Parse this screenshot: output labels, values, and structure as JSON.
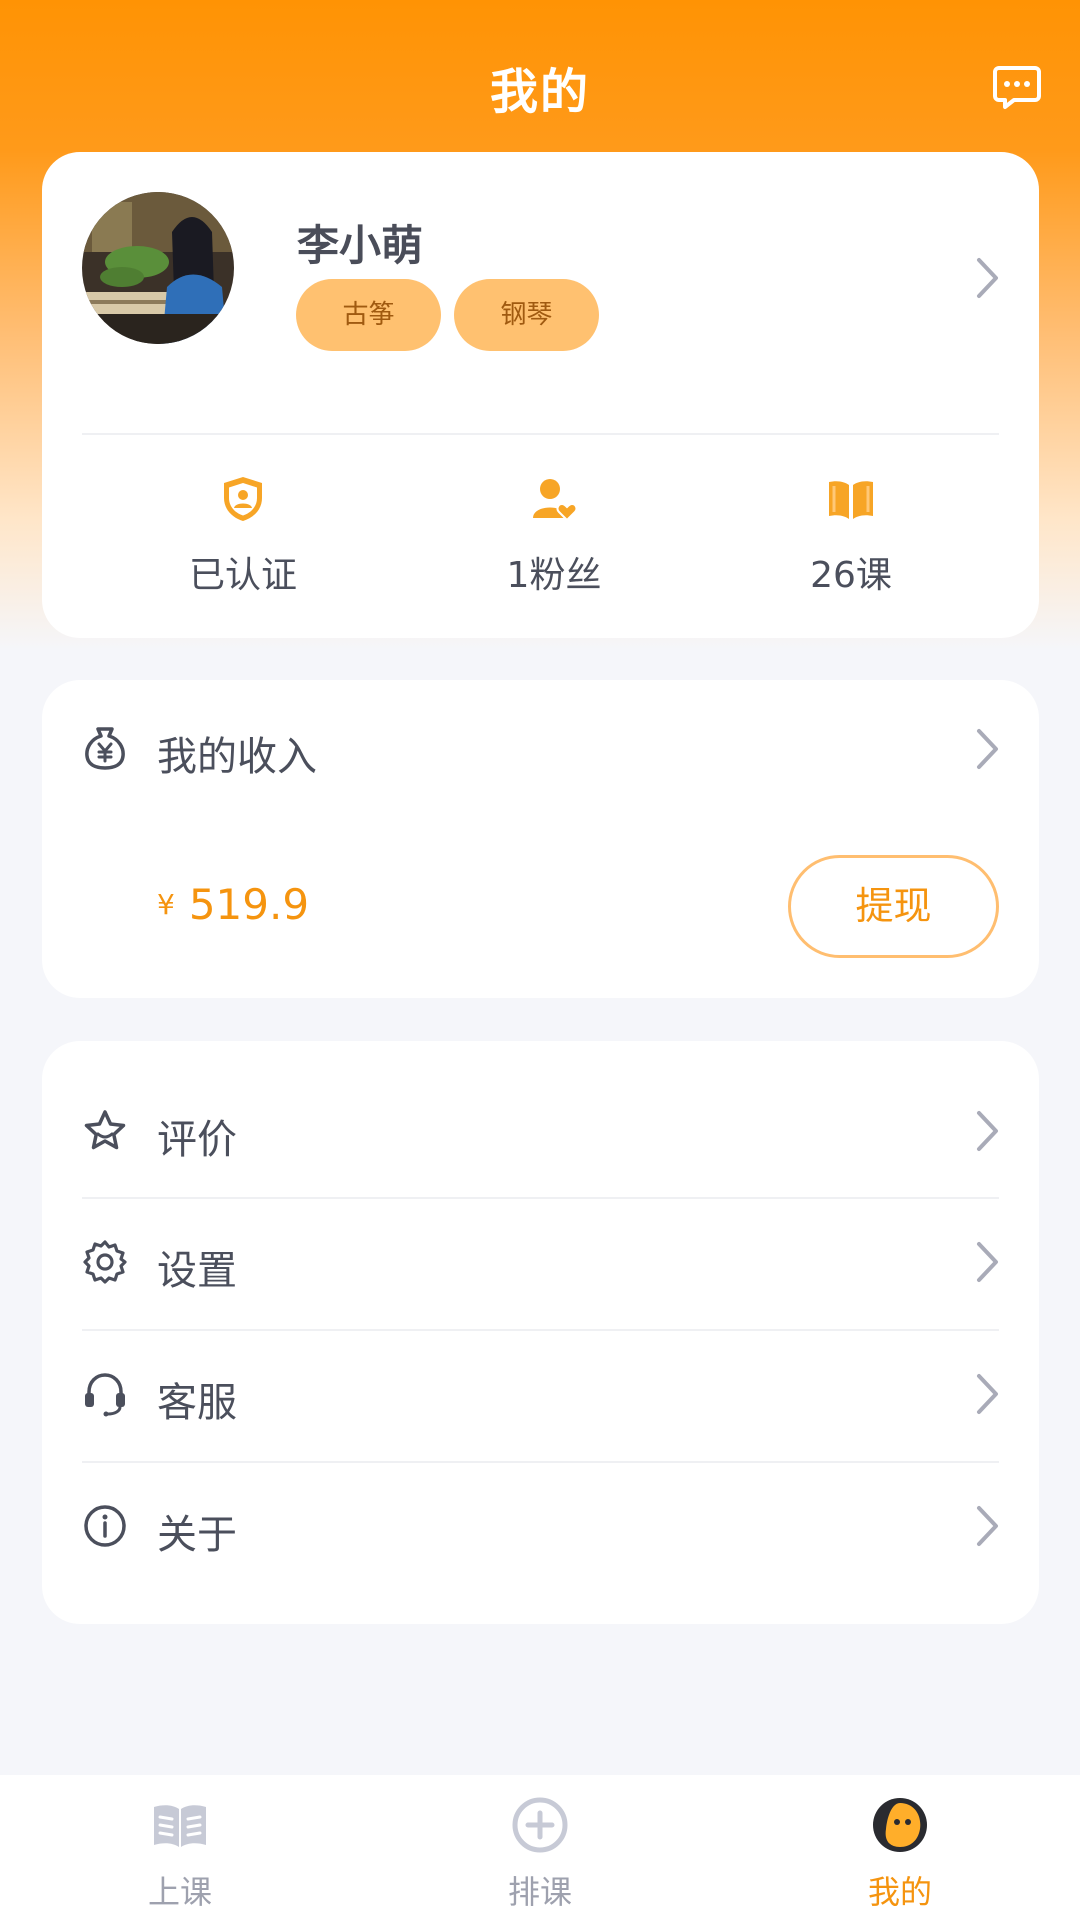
{
  "header": {
    "title": "我的",
    "message_icon": "message-icon"
  },
  "profile": {
    "name": "李小萌",
    "tags": [
      "古筝",
      "钢琴"
    ],
    "stats": [
      {
        "icon": "shield-user-icon",
        "label": "已认证"
      },
      {
        "icon": "fans-icon",
        "label": "1粉丝"
      },
      {
        "icon": "book-icon",
        "label": "26课"
      }
    ]
  },
  "income": {
    "title": "我的收入",
    "currency": "¥",
    "amount": "519.9",
    "withdraw_label": "提现"
  },
  "menu": {
    "items": [
      {
        "icon": "star-icon",
        "label": "评价"
      },
      {
        "icon": "gear-icon",
        "label": "设置"
      },
      {
        "icon": "headset-icon",
        "label": "客服"
      },
      {
        "icon": "info-icon",
        "label": "关于"
      }
    ]
  },
  "tabbar": {
    "items": [
      {
        "icon": "open-book-icon",
        "label": "上课",
        "active": false
      },
      {
        "icon": "plus-circle-icon",
        "label": "排课",
        "active": false
      },
      {
        "icon": "profile-face-icon",
        "label": "我的",
        "active": true
      }
    ]
  },
  "colors": {
    "accent": "#ff9304",
    "tag_bg": "#ffc170",
    "active_tab": "#f5940f",
    "text": "#4b4f5c"
  }
}
